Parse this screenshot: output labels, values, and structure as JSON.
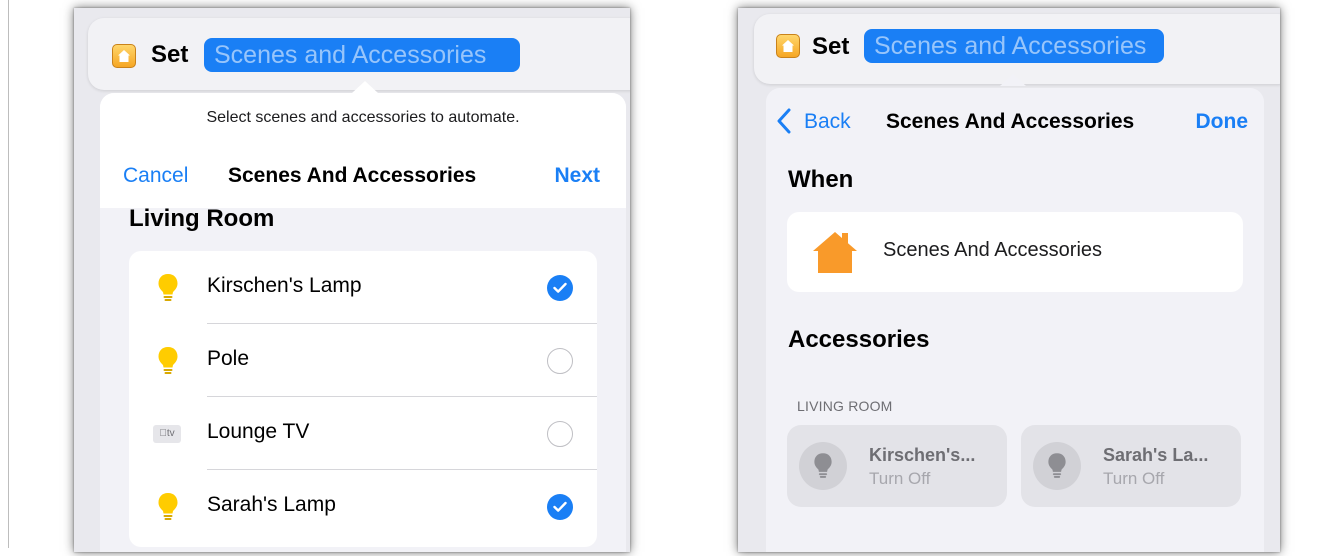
{
  "left_panel": {
    "set_label": "Set",
    "set_token": "Scenes and Accessories",
    "hint": "Select scenes and accessories to automate.",
    "cancel": "Cancel",
    "title": "Scenes And Accessories",
    "next": "Next",
    "section": "Living Room",
    "items": [
      {
        "label": "Kirschen's Lamp",
        "icon": "bulb-icon",
        "checked": true
      },
      {
        "label": "Pole",
        "icon": "bulb-icon",
        "checked": false
      },
      {
        "label": "Lounge TV",
        "icon": "apple-tv-icon",
        "icon_text": "tv",
        "checked": false
      },
      {
        "label": "Sarah's Lamp",
        "icon": "bulb-icon",
        "checked": true
      }
    ]
  },
  "right_panel": {
    "set_label": "Set",
    "set_token": "Scenes and Accessories",
    "back": "Back",
    "title": "Scenes And Accessories",
    "done": "Done",
    "when": "When",
    "when_item": "Scenes And Accessories",
    "accessories": "Accessories",
    "room": "LIVING ROOM",
    "tiles": [
      {
        "name": "Kirschen's...",
        "state": "Turn Off"
      },
      {
        "name": "Sarah's La...",
        "state": "Turn Off"
      }
    ]
  },
  "colors": {
    "accent": "#1a7ff5",
    "bulb": "#ffcc00",
    "home_orange": "#f99a2a",
    "sheet_bg": "#f2f2f7"
  }
}
